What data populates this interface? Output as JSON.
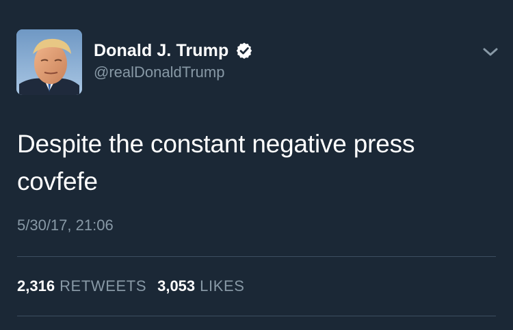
{
  "tweet": {
    "author": {
      "display_name": "Donald J. Trump",
      "handle": "@realDonaldTrump",
      "verified": true,
      "avatar_icon": "profile-photo"
    },
    "text_lines": [
      "Despite the constant negative press",
      "covfefe"
    ],
    "timestamp": "5/30/17, 21:06",
    "stats": {
      "retweets_count": "2,316",
      "retweets_label": "RETWEETS",
      "likes_count": "3,053",
      "likes_label": "LIKES"
    }
  },
  "colors": {
    "background": "#1b2836",
    "primary_text": "#ffffff",
    "secondary_text": "#8899a6",
    "divider": "#3d4f61"
  }
}
